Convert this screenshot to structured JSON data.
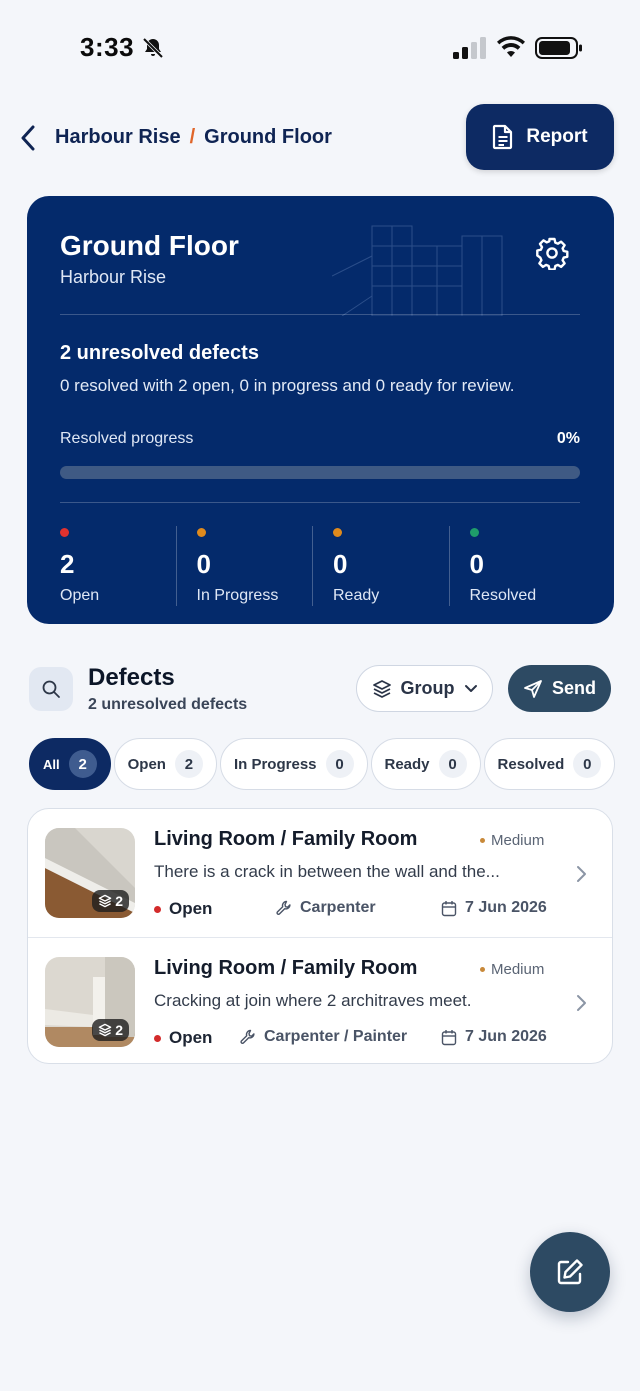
{
  "status_bar": {
    "time": "3:33"
  },
  "header": {
    "breadcrumb": {
      "project": "Harbour Rise",
      "separator": "/",
      "current": "Ground Floor"
    },
    "report_label": "Report"
  },
  "summary": {
    "title": "Ground Floor",
    "subtitle": "Harbour Rise",
    "unresolved_title": "2 unresolved defects",
    "unresolved_detail": "0 resolved with 2 open, 0 in progress and 0 ready for review.",
    "progress_label": "Resolved progress",
    "progress_percent_text": "0%",
    "progress_value": 0,
    "stats": [
      {
        "count": "2",
        "label": "Open",
        "color": "#e0322f"
      },
      {
        "count": "0",
        "label": "In Progress",
        "color": "#e08a1c"
      },
      {
        "count": "0",
        "label": "Ready",
        "color": "#e08a1c"
      },
      {
        "count": "0",
        "label": "Resolved",
        "color": "#1f9d6a"
      }
    ]
  },
  "defects": {
    "title": "Defects",
    "subtitle": "2 unresolved defects",
    "group_label": "Group",
    "send_label": "Send",
    "filters": [
      {
        "label": "All",
        "count": "2",
        "active": true
      },
      {
        "label": "Open",
        "count": "2",
        "active": false
      },
      {
        "label": "In Progress",
        "count": "0",
        "active": false
      },
      {
        "label": "Ready",
        "count": "0",
        "active": false
      },
      {
        "label": "Resolved",
        "count": "0",
        "active": false
      }
    ],
    "items": [
      {
        "title": "Living Room / Family Room",
        "priority": "Medium",
        "description": "There is a crack in between the wall and the...",
        "status": "Open",
        "trade": "Carpenter",
        "date": "7 Jun 2026",
        "photo_count": "2"
      },
      {
        "title": "Living Room / Family Room",
        "priority": "Medium",
        "description": "Cracking at join where 2 architraves meet.",
        "status": "Open",
        "trade": "Carpenter / Painter",
        "date": "7 Jun 2026",
        "photo_count": "2"
      }
    ]
  },
  "icons": {
    "bell": "bell-slash-icon",
    "signal": "cellular-signal-icon",
    "wifi": "wifi-icon",
    "battery": "battery-icon",
    "back": "chevron-left-icon",
    "report": "document-icon",
    "settings": "gear-icon",
    "search": "search-icon",
    "group": "layers-icon",
    "send": "paper-plane-icon",
    "trade": "wrench-icon",
    "date": "calendar-icon",
    "fab": "edit-icon"
  }
}
